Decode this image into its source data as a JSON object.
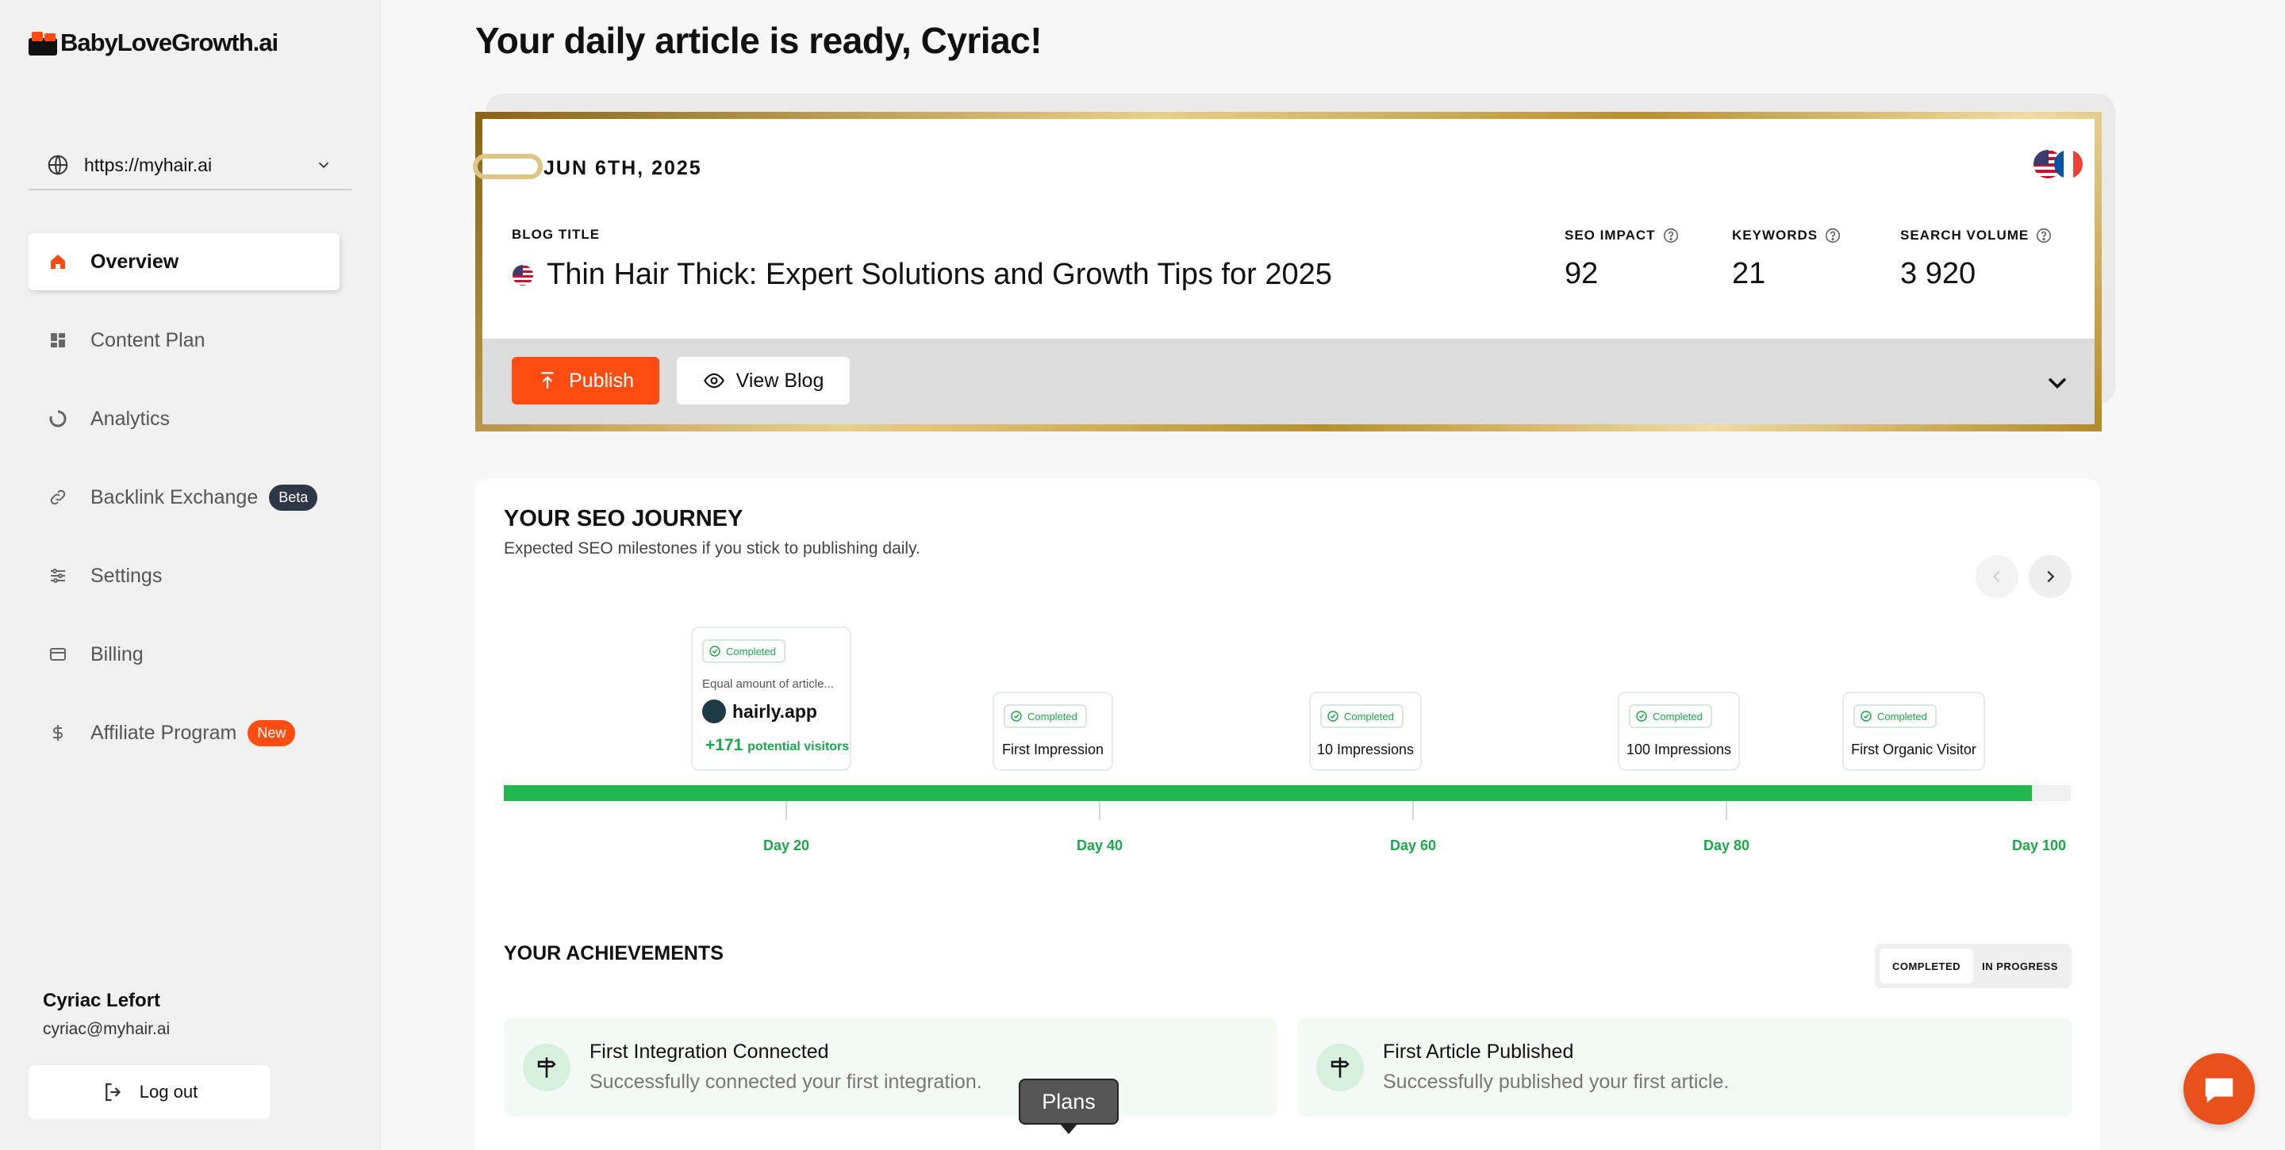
{
  "sidebar": {
    "logo_text": "BabyLoveGrowth.ai",
    "site": "https://myhair.ai",
    "items": [
      {
        "label": "Overview",
        "icon": "home-icon"
      },
      {
        "label": "Content Plan",
        "icon": "grid-icon"
      },
      {
        "label": "Analytics",
        "icon": "analytics-icon"
      },
      {
        "label": "Backlink Exchange",
        "icon": "link-icon",
        "badge": "Beta"
      },
      {
        "label": "Settings",
        "icon": "sliders-icon"
      },
      {
        "label": "Billing",
        "icon": "card-icon"
      },
      {
        "label": "Affiliate Program",
        "icon": "dollar-icon",
        "badge": "New"
      }
    ],
    "user": {
      "name": "Cyriac Lefort",
      "email": "cyriac@myhair.ai"
    },
    "logout_label": "Log out"
  },
  "main": {
    "greeting": "Your daily article is ready, Cyriac!",
    "article": {
      "date": "JUN 6TH, 2025",
      "blog_label": "BLOG TITLE",
      "title": "Thin Hair Thick: Expert Solutions and Growth Tips for 2025",
      "metrics": [
        {
          "label": "SEO IMPACT",
          "value": "92"
        },
        {
          "label": "KEYWORDS",
          "value": "21"
        },
        {
          "label": "SEARCH VOLUME",
          "value": "3 920"
        }
      ],
      "publish_label": "Publish",
      "view_label": "View Blog"
    },
    "journey": {
      "title": "YOUR SEO JOURNEY",
      "subtitle": "Expected SEO milestones if you stick to publishing daily.",
      "progress_fraction": 0.975,
      "completed_label": "Completed",
      "first_milestone": {
        "desc": "Equal amount of article...",
        "site": "hairly.app",
        "visitors_value": "+171",
        "visitors_label": "potential visitors"
      },
      "milestones": [
        "First Impression",
        "10 Impressions",
        "100 Impressions",
        "First Organic Visitor"
      ],
      "days": [
        "Day 20",
        "Day 40",
        "Day 60",
        "Day 80",
        "Day 100"
      ]
    },
    "achievements": {
      "title": "YOUR ACHIEVEMENTS",
      "tabs": [
        "COMPLETED",
        "IN PROGRESS"
      ],
      "items": [
        {
          "title": "First Integration Connected",
          "desc": "Successfully connected your first integration."
        },
        {
          "title": "First Article Published",
          "desc": "Successfully published your first article."
        }
      ]
    },
    "tooltip": "Plans"
  },
  "colors": {
    "accent": "#ff4d12",
    "success": "#22b84f",
    "gold": "#c9a227"
  }
}
